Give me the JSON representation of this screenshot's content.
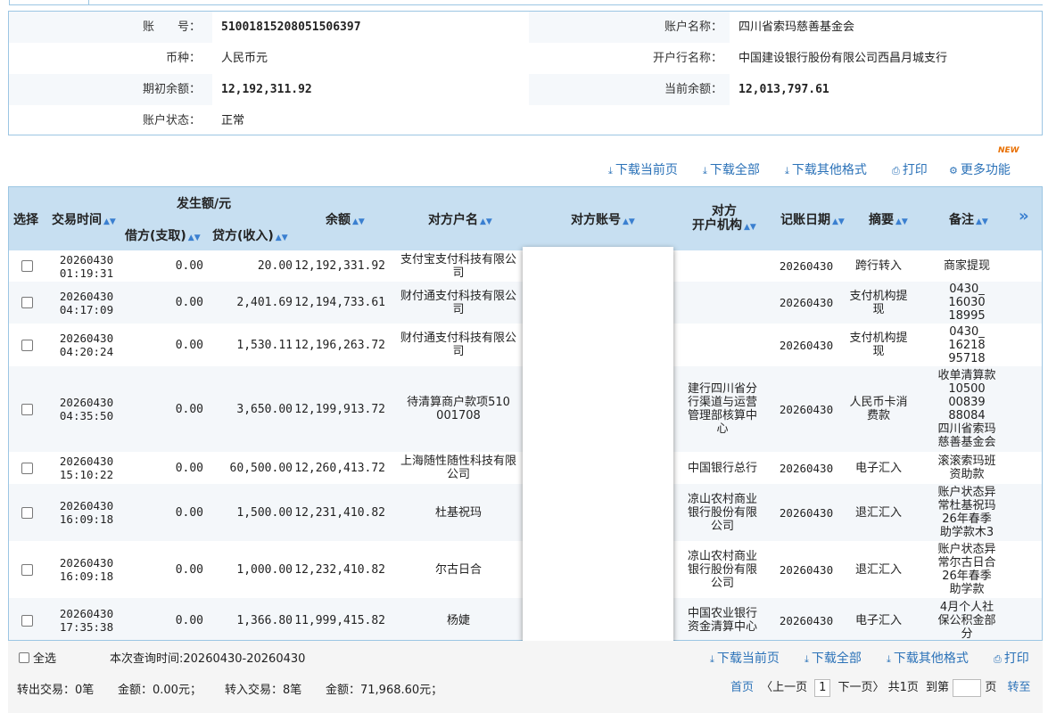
{
  "account": {
    "no_label": "账　　号：",
    "no_value": "51001815208051506397",
    "name_label": "账户名称：",
    "name_value": "四川省索玛慈善基金会",
    "currency_label": "币种：",
    "currency_value": "人民币元",
    "bank_label": "开户行名称：",
    "bank_value": "中国建设银行股份有限公司西昌月城支行",
    "opening_label": "期初余额：",
    "opening_value": "12,192,311.92",
    "current_label": "当前余额：",
    "current_value": "12,013,797.61",
    "status_label": "账户状态：",
    "status_value": "正常"
  },
  "toolbar": {
    "download_page": "下载当前页",
    "download_all": "下载全部",
    "download_other": "下载其他格式",
    "print": "打印",
    "more": "更多功能",
    "new_badge": "NEW"
  },
  "table": {
    "headers": {
      "select": "选择",
      "time": "交易时间",
      "amount_group": "发生额/元",
      "debit": "借方(支取)",
      "credit": "贷方(收入)",
      "balance": "余额",
      "cp_name": "对方户名",
      "cp_account": "对方账号",
      "cp_org_1": "对方",
      "cp_org_2": "开户机构",
      "book_date": "记账日期",
      "summary": "摘要",
      "remark": "备注",
      "more": "»"
    },
    "rows": [
      {
        "date": "20260430",
        "time": "01:19:31",
        "debit": "0.00",
        "credit": "20.00",
        "balance": "12,192,331.92",
        "cp_name": [
          "支付宝支付科技有限公",
          "司"
        ],
        "cp_org": [],
        "book_date": "20260430",
        "summary": [
          "跨行转入"
        ],
        "remark": [
          "商家提现"
        ]
      },
      {
        "date": "20260430",
        "time": "04:17:09",
        "debit": "0.00",
        "credit": "2,401.69",
        "balance": "12,194,733.61",
        "cp_name": [
          "财付通支付科技有限公",
          "司"
        ],
        "cp_org": [],
        "book_date": "20260430",
        "summary": [
          "支付机构提",
          "现"
        ],
        "remark": [
          "0430_",
          "16030",
          "18995"
        ]
      },
      {
        "date": "20260430",
        "time": "04:20:24",
        "debit": "0.00",
        "credit": "1,530.11",
        "balance": "12,196,263.72",
        "cp_name": [
          "财付通支付科技有限公",
          "司"
        ],
        "cp_org": [],
        "book_date": "20260430",
        "summary": [
          "支付机构提",
          "现"
        ],
        "remark": [
          "0430_",
          "16218",
          "95718"
        ]
      },
      {
        "date": "20260430",
        "time": "04:35:50",
        "debit": "0.00",
        "credit": "3,650.00",
        "balance": "12,199,913.72",
        "cp_name": [
          "待清算商户款项510",
          "001708"
        ],
        "cp_org": [
          "建行四川省分",
          "行渠道与运营",
          "管理部核算中",
          "心"
        ],
        "book_date": "20260430",
        "summary": [
          "人民币卡消",
          "费款"
        ],
        "remark": [
          "收单清算款",
          "10500",
          "00839",
          "88084",
          "四川省索玛",
          "慈善基金会"
        ]
      },
      {
        "date": "20260430",
        "time": "15:10:22",
        "debit": "0.00",
        "credit": "60,500.00",
        "balance": "12,260,413.72",
        "cp_name": [
          "上海随性随性科技有限",
          "公司"
        ],
        "cp_org": [
          "中国银行总行"
        ],
        "book_date": "20260430",
        "summary": [
          "电子汇入"
        ],
        "remark": [
          "滚滚索玛班",
          "资助款"
        ]
      },
      {
        "date": "20260430",
        "time": "16:09:18",
        "debit": "0.00",
        "credit": "1,500.00",
        "balance": "12,231,410.82",
        "cp_name": [
          "杜基祝玛"
        ],
        "cp_org": [
          "凉山农村商业",
          "银行股份有限",
          "公司"
        ],
        "book_date": "20260430",
        "summary": [
          "退汇汇入"
        ],
        "remark": [
          "账户状态异",
          "常杜基祝玛",
          "26年春季",
          "助学款木3"
        ]
      },
      {
        "date": "20260430",
        "time": "16:09:18",
        "debit": "0.00",
        "credit": "1,000.00",
        "balance": "12,232,410.82",
        "cp_name": [
          "尔古日合"
        ],
        "cp_org": [
          "凉山农村商业",
          "银行股份有限",
          "公司"
        ],
        "book_date": "20260430",
        "summary": [
          "退汇汇入"
        ],
        "remark": [
          "账户状态异",
          "常尔古日合",
          "26年春季",
          "助学款"
        ]
      },
      {
        "date": "20260430",
        "time": "17:35:38",
        "debit": "0.00",
        "credit": "1,366.80",
        "balance": "11,999,415.82",
        "cp_name": [
          "杨婕"
        ],
        "cp_org": [
          "中国农业银行",
          "资金清算中心"
        ],
        "book_date": "20260430",
        "summary": [
          "电子汇入"
        ],
        "remark": [
          "4月个人社",
          "保公积金部",
          "分"
        ]
      }
    ]
  },
  "footer": {
    "select_all": "全选",
    "query_time": "本次查询时间:20260430-20260430",
    "download_page": "下载当前页",
    "download_all": "下载全部",
    "download_other": "下载其他格式",
    "print": "打印",
    "out_tx": "转出交易：0笔",
    "out_amount": "金额：0.00元；",
    "in_tx": "转入交易：8笔",
    "in_amount": "金额：71,968.60元；",
    "first": "首页",
    "prev": "〈上一页",
    "page_num": "1",
    "next": "下一页〉",
    "total": "共1页",
    "goto": "到第",
    "page_unit": "页",
    "go": "转至"
  }
}
